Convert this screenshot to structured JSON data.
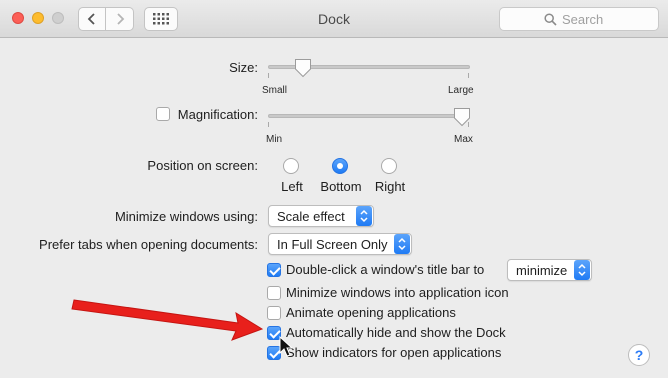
{
  "window": {
    "title": "Dock"
  },
  "search": {
    "placeholder": "Search"
  },
  "size": {
    "label": "Size:",
    "min_label": "Small",
    "max_label": "Large",
    "value": 0.07
  },
  "magnification": {
    "label": "Magnification:",
    "checked": false,
    "min_label": "Min",
    "max_label": "Max",
    "value": 1.0
  },
  "position": {
    "label": "Position on screen:",
    "options": [
      "Left",
      "Bottom",
      "Right"
    ],
    "selected": "Bottom"
  },
  "minimize": {
    "label": "Minimize windows using:",
    "value": "Scale effect"
  },
  "prefer_tabs": {
    "label": "Prefer tabs when opening documents:",
    "value": "In Full Screen Only"
  },
  "checkboxes": [
    {
      "label": "Double-click a window's title bar to",
      "checked": true
    },
    {
      "label": "Minimize windows into application icon",
      "checked": false
    },
    {
      "label": "Animate opening applications",
      "checked": false
    },
    {
      "label": "Automatically hide and show the Dock",
      "checked": true
    },
    {
      "label": "Show indicators for open applications",
      "checked": true
    }
  ],
  "double_click_action": {
    "value": "minimize"
  },
  "help": {
    "label": "?"
  },
  "colors": {
    "accent": "#1f7bf4",
    "annotation_arrow": "#e8201c"
  },
  "icons": [
    "back-icon",
    "forward-icon",
    "grid-icon",
    "search-icon",
    "help-icon",
    "mouse-pointer-icon",
    "annotation-arrow-icon"
  ]
}
